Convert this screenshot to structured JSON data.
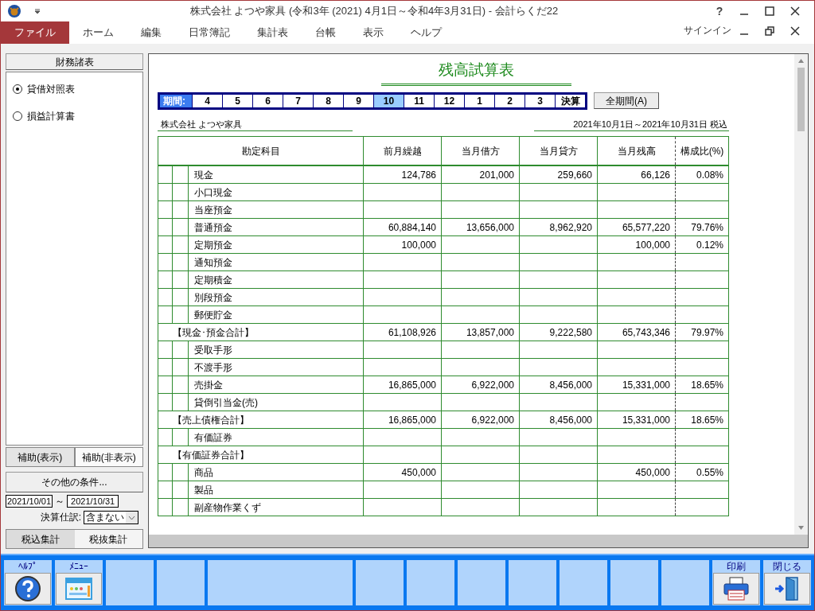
{
  "window": {
    "title": "株式会社  よつや家具 (令和3年 (2021) 4月1日～令和4年3月31日) - 会計らくだ22",
    "help": "?",
    "signin": "サインイン"
  },
  "menu": [
    {
      "label": "ファイル",
      "selected": true
    },
    {
      "label": "ホーム",
      "selected": false
    },
    {
      "label": "編集",
      "selected": false
    },
    {
      "label": "日常簿記",
      "selected": false
    },
    {
      "label": "集計表",
      "selected": false
    },
    {
      "label": "台帳",
      "selected": false
    },
    {
      "label": "表示",
      "selected": false
    },
    {
      "label": "ヘルプ",
      "selected": false
    }
  ],
  "sidebar": {
    "heading": "財務諸表",
    "reports": [
      {
        "label": "貸借対照表",
        "selected": true
      },
      {
        "label": "損益計算書",
        "selected": false
      }
    ],
    "sub_tabs": [
      {
        "label": "補助(表示)",
        "selected": true
      },
      {
        "label": "補助(非表示)",
        "selected": false
      }
    ],
    "conditions_button": "その他の条件...",
    "date_from": "2021/10/01",
    "date_separator": "～",
    "date_to": "2021/10/31",
    "closing_label": "決算仕訳:",
    "closing_value": "含まない",
    "tax_tabs": [
      {
        "label": "税込集計",
        "selected": true
      },
      {
        "label": "税抜集計",
        "selected": false
      }
    ]
  },
  "report": {
    "title": "残高試算表",
    "period_label": "期間:",
    "periods": [
      {
        "label": "4",
        "selected": false
      },
      {
        "label": "5",
        "selected": false
      },
      {
        "label": "6",
        "selected": false
      },
      {
        "label": "7",
        "selected": false
      },
      {
        "label": "8",
        "selected": false
      },
      {
        "label": "9",
        "selected": false
      },
      {
        "label": "10",
        "selected": true
      },
      {
        "label": "11",
        "selected": false
      },
      {
        "label": "12",
        "selected": false
      },
      {
        "label": "1",
        "selected": false
      },
      {
        "label": "2",
        "selected": false
      },
      {
        "label": "3",
        "selected": false
      },
      {
        "label": "決算",
        "selected": false
      }
    ],
    "all_periods_button": "全期間(A)",
    "company": "株式会社  よつや家具",
    "date_range": "2021年10月1日～2021年10月31日  税込",
    "columns": [
      "勘定科目",
      "前月繰越",
      "当月借方",
      "当月貸方",
      "当月残高",
      "構成比(%)"
    ],
    "rows": [
      {
        "kind": "item",
        "account": "現金",
        "prior": "124,786",
        "debit": "201,000",
        "credit": "259,660",
        "balance": "66,126",
        "ratio": "0.08%"
      },
      {
        "kind": "item",
        "account": "小口現金"
      },
      {
        "kind": "item",
        "account": "当座預金"
      },
      {
        "kind": "item",
        "account": "普通預金",
        "prior": "60,884,140",
        "debit": "13,656,000",
        "credit": "8,962,920",
        "balance": "65,577,220",
        "ratio": "79.76%"
      },
      {
        "kind": "item",
        "account": "定期預金",
        "prior": "100,000",
        "balance": "100,000",
        "ratio": "0.12%"
      },
      {
        "kind": "item",
        "account": "通知預金"
      },
      {
        "kind": "item",
        "account": "定期積金"
      },
      {
        "kind": "item",
        "account": "別段預金"
      },
      {
        "kind": "item",
        "account": "郵便貯金"
      },
      {
        "kind": "total",
        "account": "【現金･預金合計】",
        "prior": "61,108,926",
        "debit": "13,857,000",
        "credit": "9,222,580",
        "balance": "65,743,346",
        "ratio": "79.97%"
      },
      {
        "kind": "item",
        "account": "受取手形"
      },
      {
        "kind": "item",
        "account": "不渡手形"
      },
      {
        "kind": "item",
        "account": "売掛金",
        "prior": "16,865,000",
        "debit": "6,922,000",
        "credit": "8,456,000",
        "balance": "15,331,000",
        "ratio": "18.65%"
      },
      {
        "kind": "item",
        "account": "貸倒引当金(売)"
      },
      {
        "kind": "total",
        "account": "【売上債権合計】",
        "prior": "16,865,000",
        "debit": "6,922,000",
        "credit": "8,456,000",
        "balance": "15,331,000",
        "ratio": "18.65%"
      },
      {
        "kind": "item",
        "account": "有価証券"
      },
      {
        "kind": "total",
        "account": "【有価証券合計】"
      },
      {
        "kind": "item",
        "account": "商品",
        "prior": "450,000",
        "balance": "450,000",
        "ratio": "0.55%"
      },
      {
        "kind": "item",
        "account": "製品"
      },
      {
        "kind": "item",
        "account": "副産物作業くず"
      }
    ]
  },
  "toolbar": [
    {
      "kind": "help",
      "label": "ﾍﾙﾌﾟ"
    },
    {
      "kind": "menu",
      "label": "ﾒﾆｭｰ"
    },
    {
      "kind": "empty"
    },
    {
      "kind": "empty"
    },
    {
      "kind": "wide"
    },
    {
      "kind": "empty"
    },
    {
      "kind": "empty"
    },
    {
      "kind": "empty"
    },
    {
      "kind": "empty"
    },
    {
      "kind": "empty"
    },
    {
      "kind": "empty"
    },
    {
      "kind": "empty"
    },
    {
      "kind": "print",
      "label": "印刷"
    },
    {
      "kind": "close",
      "label": "閉じる"
    }
  ]
}
